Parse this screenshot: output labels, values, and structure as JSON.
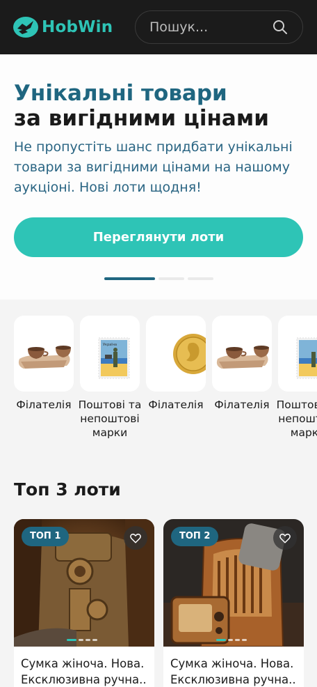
{
  "header": {
    "logo_text": "HobWin",
    "search_placeholder": "Пошук...",
    "colors": {
      "background": "#1b1b1b",
      "accent": "#2ec4b6"
    }
  },
  "hero": {
    "title_line1": "Унікальні товари",
    "title_line2": "за вигідними цінами",
    "description": "Не пропустіть шанс придбати унікальні товари за вигідними цінами на нашому аукціоні. Нові лоти щодня!",
    "cta_label": "Переглянути лоти",
    "slide_count": 3,
    "active_slide": 1
  },
  "categories": [
    {
      "label": "Філателія",
      "icon": "clay-cups-image"
    },
    {
      "label": "Поштові та непоштові марки",
      "icon": "ukraine-stamp-image"
    },
    {
      "label": "Філателія",
      "icon": "gold-coin-image"
    },
    {
      "label": "Філателія",
      "icon": "clay-cups-image"
    },
    {
      "label": "Поштові та непоштові марки",
      "icon": "ukraine-stamp-image"
    }
  ],
  "top_lots": {
    "title": "Топ 3 лоти",
    "items": [
      {
        "badge": "ТОП 1",
        "title": "Сумка жіноча. Нова. Ексклюзивна ручна..",
        "image": "antique-door-lock-image",
        "favorite_icon": "heart-icon"
      },
      {
        "badge": "ТОП 2",
        "title": "Сумка жіноча. Нова. Ексклюзивна ручна..",
        "image": "vintage-radio-image",
        "favorite_icon": "heart-icon"
      }
    ]
  }
}
